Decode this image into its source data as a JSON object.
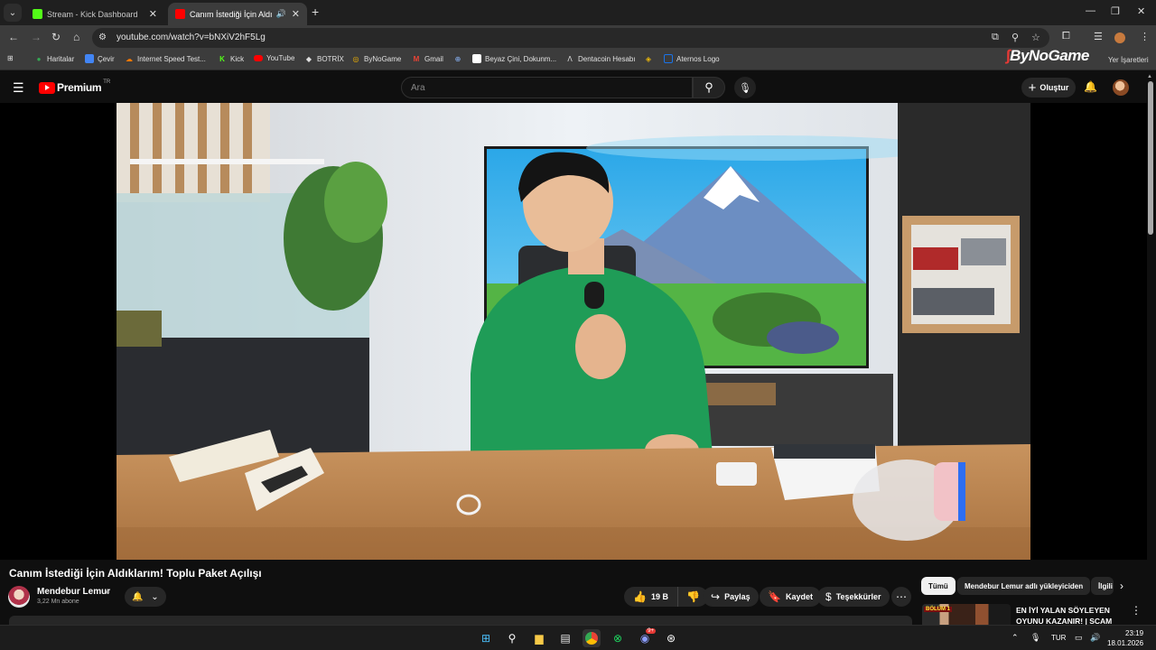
{
  "browser": {
    "tabs": [
      {
        "label": "Stream - Kick Dashboard",
        "active": false,
        "favicon_color": "#53fc18"
      },
      {
        "label": "Canım İstediği İçin Aldıklarım",
        "active": true,
        "favicon_color": "#ff0000"
      }
    ],
    "url": "youtube.com/watch?v=bNXiV2hF5Lg",
    "bookmarks": [
      {
        "label": "Haritalar",
        "icon": "maps-pin-icon",
        "color": "#34a853"
      },
      {
        "label": "Çevir",
        "icon": "translate-icon",
        "color": "#4285f4"
      },
      {
        "label": "Internet Speed Test...",
        "icon": "speedtest-icon",
        "color": "#ff7a00"
      },
      {
        "label": "Kick",
        "icon": "kick-icon",
        "color": "#53fc18"
      },
      {
        "label": "YouTube",
        "icon": "youtube-icon",
        "color": "#ff0000"
      },
      {
        "label": "BOTRİX",
        "icon": "botrix-icon",
        "color": "#ffffff"
      },
      {
        "label": "ByNoGame",
        "icon": "bynogame-icon",
        "color": "#f4b400"
      },
      {
        "label": "Gmail",
        "icon": "gmail-icon",
        "color": "#ea4335"
      },
      {
        "label": "",
        "icon": "globe-icon",
        "color": "#8ab4f8"
      },
      {
        "label": "Beyaz Çini, Dokunm...",
        "icon": "tile-icon",
        "color": "#ffffff"
      },
      {
        "label": "Dentacoin Hesabı",
        "icon": "dentacoin-icon",
        "color": "#ffffff"
      },
      {
        "label": "",
        "icon": "binance-icon",
        "color": "#f0b90b"
      },
      {
        "label": "Aternos Logo",
        "icon": "image-icon",
        "color": "#1a73e8"
      }
    ],
    "brand_logo": "ByNoGame",
    "other_bookmarks": "Yer İşaretleri"
  },
  "youtube": {
    "logo_text": "Premium",
    "country_code": "TR",
    "search_placeholder": "Ara",
    "create_label": "Oluştur",
    "video_title": "Canım İstediği İçin Aldıklarım! Toplu Paket Açılışı",
    "channel_name": "Mendebur Lemur",
    "subscribers": "3,22 Mn abone",
    "likes": "19 B",
    "share_label": "Paylaş",
    "save_label": "Kaydet",
    "thanks_label": "Teşekkürler",
    "chips": [
      "Tümü",
      "Mendebur Lemur adlı yükleyiciden",
      "İlgili"
    ],
    "recommended": {
      "badge": "BÖLÜM 1",
      "title": "EN İYİ YALAN SÖYLEYEN OYUNU KAZANIR! | SCAM LİN"
    }
  },
  "taskbar": {
    "apps": [
      "windows-start-icon",
      "search-icon",
      "file-explorer-icon",
      "store-icon",
      "chrome-icon",
      "xbox-icon",
      "discord-icon",
      "steam-icon"
    ],
    "language": "TUR",
    "time": "23:19",
    "date": "18.01.2026",
    "discord_badge": "9+"
  },
  "colors": {
    "accent_red": "#ff0000",
    "bg": "#0f0f0f",
    "surface": "#272727"
  }
}
